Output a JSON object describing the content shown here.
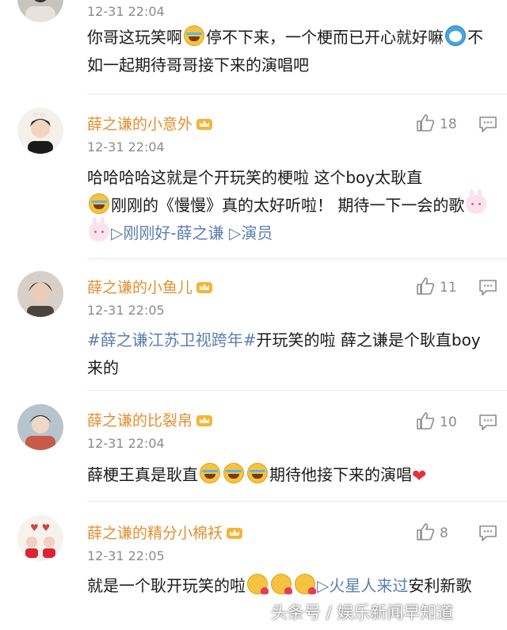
{
  "comments": [
    {
      "username": "",
      "time": "12-31 22:04",
      "likes": "",
      "text_parts": [
        "你哥这玩笑啊",
        "停不下来，一个梗而已开心就好嘛",
        "不如一起期待哥哥接下来的演唱吧"
      ]
    },
    {
      "username": "薛之谦的小意外",
      "time": "12-31 22:04",
      "likes": "18",
      "text_parts": [
        "哈哈哈哈这就是个开玩笑的梗啦  这个boy太耿直",
        "刚刚的《慢慢》真的太好听啦！ 期待一下一会的歌",
        "▷刚刚好-薛之谦",
        "▷演员"
      ]
    },
    {
      "username": "薛之谦的小鱼儿",
      "time": "12-31 22:05",
      "likes": "11",
      "text_parts": [
        "#薛之谦江苏卫视跨年#",
        "开玩笑的啦  薛之谦是个耿直boy来的"
      ]
    },
    {
      "username": "薛之谦的比裂帛",
      "time": "12-31 22:04",
      "likes": "10",
      "text_parts": [
        "薛梗王真是耿直",
        "期待他接下来的演唱"
      ]
    },
    {
      "username": "薛之谦的精分小棉袄",
      "time": "12-31 22:05",
      "likes": "8",
      "text_parts": [
        "就是一个耿开玩笑的啦",
        "▷火星人来过",
        "安利新歌"
      ]
    }
  ],
  "icons": {
    "like": "thumbs-up-icon",
    "reply": "comment-icon",
    "badge": "crown-icon"
  },
  "colors": {
    "username": "#e38f30",
    "link": "#5b7fb0",
    "meta": "#8c8c8c"
  },
  "watermark": "头条号 / 娱乐新闻早知道"
}
